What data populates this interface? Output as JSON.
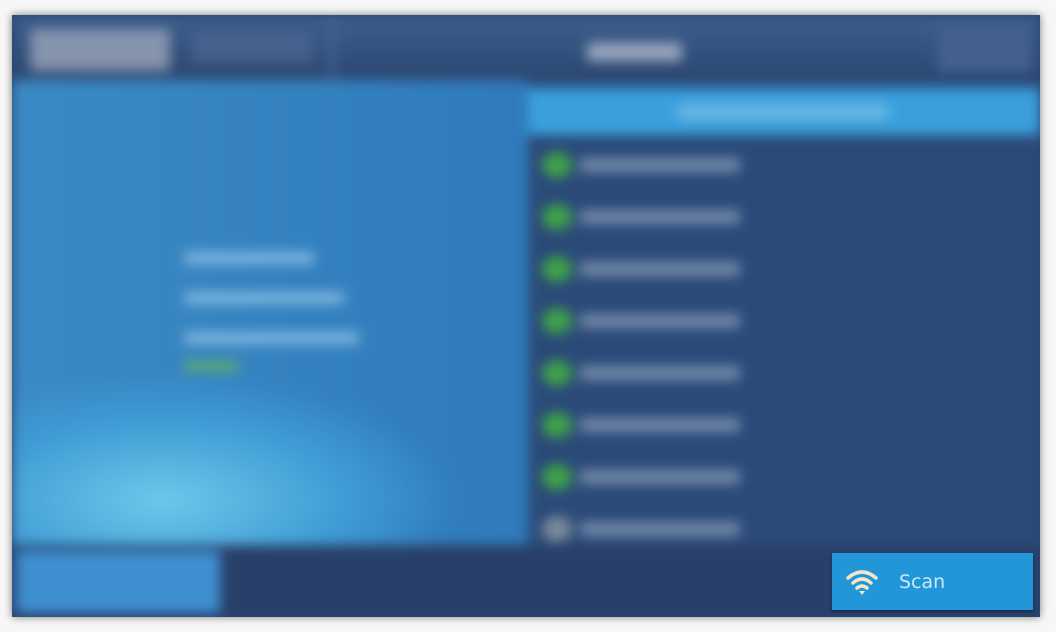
{
  "scan_button": {
    "label": "Scan",
    "icon": "wifi-icon"
  },
  "device_list": {
    "item_count": 8,
    "status_color": "#3ea24a"
  },
  "colors": {
    "accent": "#2196d8",
    "header": "#2b4670",
    "list_header": "#3aa0dc"
  }
}
